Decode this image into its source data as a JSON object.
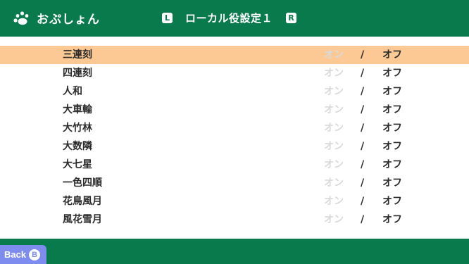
{
  "header": {
    "brand": "おぷしょん",
    "brand_icon": "paw-icon",
    "title": "ローカル役設定１",
    "left_key": "L",
    "right_key": "R"
  },
  "rules": [
    {
      "name": "三連刻",
      "on_label": "オン",
      "separator": "/",
      "off_label": "オフ",
      "value": "オフ",
      "selected": true
    },
    {
      "name": "四連刻",
      "on_label": "オン",
      "separator": "/",
      "off_label": "オフ",
      "value": "オフ",
      "selected": false
    },
    {
      "name": "人和",
      "on_label": "オン",
      "separator": "/",
      "off_label": "オフ",
      "value": "オフ",
      "selected": false
    },
    {
      "name": "大車輪",
      "on_label": "オン",
      "separator": "/",
      "off_label": "オフ",
      "value": "オフ",
      "selected": false
    },
    {
      "name": "大竹林",
      "on_label": "オン",
      "separator": "/",
      "off_label": "オフ",
      "value": "オフ",
      "selected": false
    },
    {
      "name": "大数隣",
      "on_label": "オン",
      "separator": "/",
      "off_label": "オフ",
      "value": "オフ",
      "selected": false
    },
    {
      "name": "大七星",
      "on_label": "オン",
      "separator": "/",
      "off_label": "オフ",
      "value": "オフ",
      "selected": false
    },
    {
      "name": "一色四順",
      "on_label": "オン",
      "separator": "/",
      "off_label": "オフ",
      "value": "オフ",
      "selected": false
    },
    {
      "name": "花鳥風月",
      "on_label": "オン",
      "separator": "/",
      "off_label": "オフ",
      "value": "オフ",
      "selected": false
    },
    {
      "name": "風花雪月",
      "on_label": "オン",
      "separator": "/",
      "off_label": "オフ",
      "value": "オフ",
      "selected": false
    }
  ],
  "footer": {
    "back_label": "Back",
    "back_key": "B"
  },
  "colors": {
    "bar": "#087a4c",
    "selected_row": "#fcc995",
    "inactive_option": "#d9d9d9",
    "active_option": "#2a2a2a",
    "back_button": "#7e8cf0"
  }
}
